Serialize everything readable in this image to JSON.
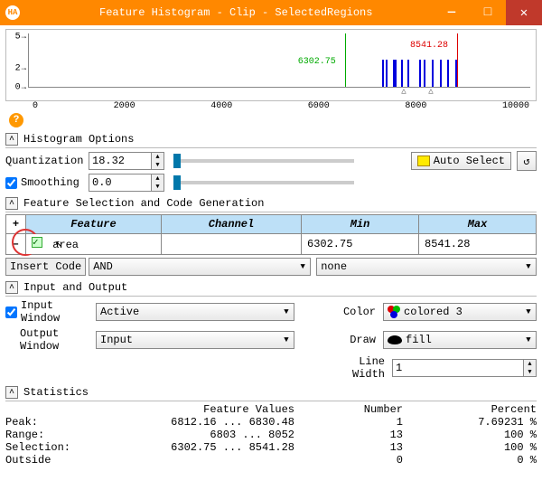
{
  "window": {
    "title": "Feature Histogram - Clip - SelectedRegions",
    "icon_text": "HA"
  },
  "chart_data": {
    "type": "bar",
    "y_ticks": [
      0,
      2,
      5
    ],
    "x_ticks": [
      0,
      2000,
      4000,
      6000,
      8000,
      10000
    ],
    "green_line": {
      "x": 6302.75,
      "label": "6302.75"
    },
    "red_line": {
      "x": 8541.28,
      "label": "8541.28"
    },
    "blue_marks_x": [
      7050,
      7120,
      7260,
      7300,
      7420,
      7550,
      7780,
      7880,
      8040,
      8200,
      8350,
      8500
    ],
    "arrow_marks_x": [
      7500,
      8040
    ]
  },
  "sections": {
    "histogram_options": "Histogram Options",
    "feature_sel": "Feature Selection and Code Generation",
    "io": "Input and Output",
    "stats": "Statistics"
  },
  "hist_opts": {
    "quant_label": "Quantization",
    "quant_value": "18.32",
    "smooth_label": "Smoothing",
    "smooth_value": "0.0",
    "auto_select": "Auto Select"
  },
  "table": {
    "h_feature": "Feature",
    "h_channel": "Channel",
    "h_min": "Min",
    "h_max": "Max",
    "row1": {
      "feature": "area",
      "channel": "",
      "min": "6302.75",
      "max": "8541.28"
    }
  },
  "code": {
    "insert_label": "Insert Code",
    "op": "AND",
    "target": "none"
  },
  "io": {
    "input_window_label": "Input Window",
    "input_window_val": "Active",
    "output_window_label": "Output Window",
    "output_window_val": "Input",
    "color_label": "Color",
    "color_val": "colored 3",
    "draw_label": "Draw",
    "draw_val": "fill",
    "lw_label": "Line Width",
    "lw_val": "1"
  },
  "stats": {
    "h_fv": "Feature Values",
    "h_num": "Number",
    "h_pct": "Percent",
    "rows": [
      {
        "name": "Peak:",
        "fv": "6812.16 ... 6830.48",
        "num": "1",
        "pct": "7.69231 %"
      },
      {
        "name": "Range:",
        "fv": "6803 ... 8052",
        "num": "13",
        "pct": "100 %"
      },
      {
        "name": "Selection:",
        "fv": "6302.75 ... 8541.28",
        "num": "13",
        "pct": "100 %"
      },
      {
        "name": "Outside",
        "fv": "",
        "num": "0",
        "pct": "0 %"
      }
    ]
  }
}
